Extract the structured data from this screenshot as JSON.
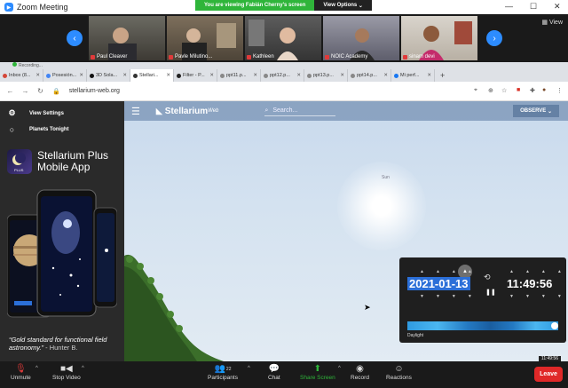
{
  "zoom": {
    "window_title": "Zoom Meeting",
    "banner_viewing": "You are viewing Fabián Cherny's screen",
    "banner_options": "View Options",
    "view_button": "View",
    "participants": [
      {
        "name": "Paul Cleaver"
      },
      {
        "name": "Pavle Milutino..."
      },
      {
        "name": "Kathleen"
      },
      {
        "name": "NOIC Academy"
      },
      {
        "name": "sinam devi"
      }
    ],
    "recording_label": "Recording...",
    "toolbar": {
      "unmute": "Unmute",
      "stop_video": "Stop Video",
      "participants": "Participants",
      "participants_count": "22",
      "chat": "Chat",
      "share_screen": "Share Screen",
      "record": "Record",
      "reactions": "Reactions",
      "leave": "Leave"
    }
  },
  "browser": {
    "tabs": [
      {
        "label": "Inbox (8..."
      },
      {
        "label": "Posesión..."
      },
      {
        "label": "3D Sola..."
      },
      {
        "label": "Stellari..."
      },
      {
        "label": "Filter - P..."
      },
      {
        "label": "ppt11.p..."
      },
      {
        "label": "ppt12.p..."
      },
      {
        "label": "ppt13.p..."
      },
      {
        "label": "ppt14.p..."
      },
      {
        "label": "Mi perf..."
      }
    ],
    "active_tab_index": 3,
    "url": "stellarium-web.org"
  },
  "stellarium": {
    "sidebar": {
      "view_settings": "View Settings",
      "planets_tonight": "Planets Tonight",
      "promo_title_line1": "Stellarium Plus",
      "promo_title_line2": "Mobile App",
      "promo_icon_text": "PLUS",
      "quote": "“Gold standard for functional field astronomy.”",
      "quote_author": "- Hunter B."
    },
    "brand": "Stellarium",
    "brand_sup": "Web",
    "search_placeholder": "Search...",
    "observe_label": "OBSERVE",
    "sun_label": "Sun",
    "date": "2021-01-13",
    "time": "11:49:56",
    "slider_label": "Daylight",
    "time_stamp": "11:49:56"
  }
}
